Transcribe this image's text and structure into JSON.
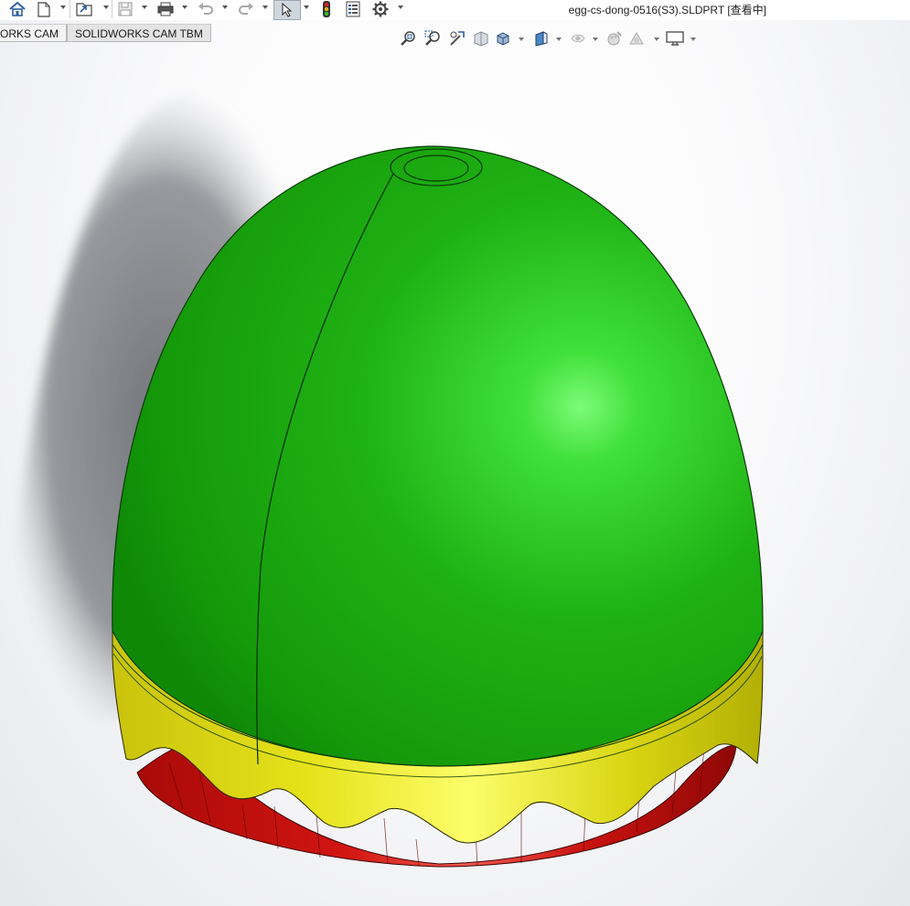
{
  "app": {
    "document_title": "egg-cs-dong-0516(S3).SLDPRT [查看中]"
  },
  "toolbar": {
    "icons": [
      "home-icon",
      "new-document-icon",
      "open-icon",
      "save-icon",
      "print-icon",
      "undo-icon",
      "redo-icon",
      "select-arrow-icon",
      "rebuild-traffic-light-icon",
      "file-properties-icon",
      "options-gear-icon"
    ]
  },
  "tabs": [
    {
      "label": "ORKS CAM"
    },
    {
      "label": "SOLIDWORKS CAM TBM"
    }
  ],
  "view_toolbar": {
    "icons": [
      "zoom-to-fit-icon",
      "zoom-to-area-icon",
      "previous-view-icon",
      "section-view-icon",
      "view-orientation-icon",
      "display-style-icon",
      "hide-show-items-icon",
      "edit-appearance-icon",
      "apply-scene-icon",
      "view-settings-icon"
    ]
  },
  "model": {
    "name": "egg shell part",
    "colors": {
      "shell": "#1fb20f",
      "band": "#d6d40e",
      "base": "#c2100e"
    }
  }
}
